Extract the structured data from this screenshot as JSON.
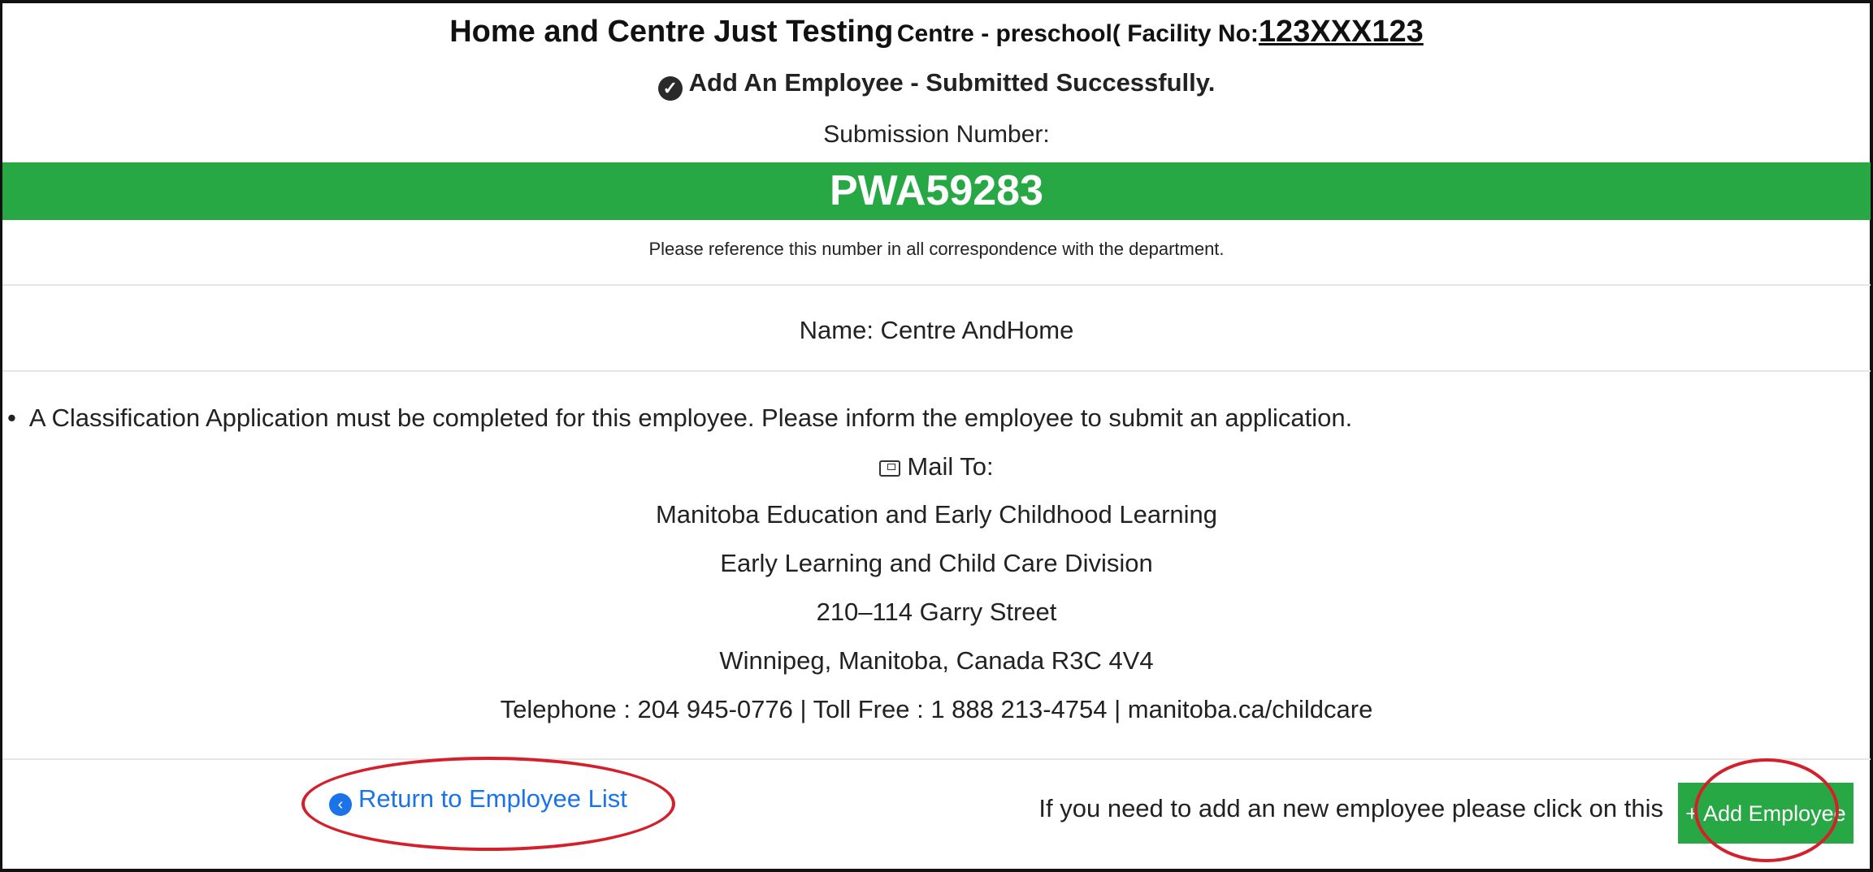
{
  "header": {
    "title_main": "Home and Centre Just Testing",
    "title_sub": "Centre - preschool( Facility No:",
    "facility_no": "123XXX123"
  },
  "status": {
    "success_message": "Add An Employee - Submitted Successfully.",
    "submission_label": "Submission Number:",
    "submission_number": "PWA59283",
    "reference_note": "Please reference this number in all correspondence with the department."
  },
  "employee": {
    "name_line": "Name: Centre AndHome"
  },
  "notice": {
    "bullet": "•",
    "text": "A Classification Application must be completed for this employee. Please inform the employee to submit an application."
  },
  "mail": {
    "label": "Mail To:",
    "lines": [
      "Manitoba Education and Early Childhood Learning",
      "Early Learning and Child Care Division",
      "210–114 Garry Street",
      "Winnipeg, Manitoba, Canada R3C 4V4",
      "Telephone : 204 945-0776 | Toll Free : 1 888 213-4754 | manitoba.ca/childcare"
    ]
  },
  "actions": {
    "return_label": "Return to Employee List",
    "add_prompt": "If you need to add an new employee please click on this",
    "add_button_label": "+ Add Employee"
  },
  "icons": {
    "success": "check-circle-icon",
    "mail": "mailbox-icon",
    "return": "arrow-left-circle-icon"
  },
  "colors": {
    "accent_green": "#28a745",
    "link_blue": "#1a73e8",
    "highlight_red": "#d4202b"
  }
}
